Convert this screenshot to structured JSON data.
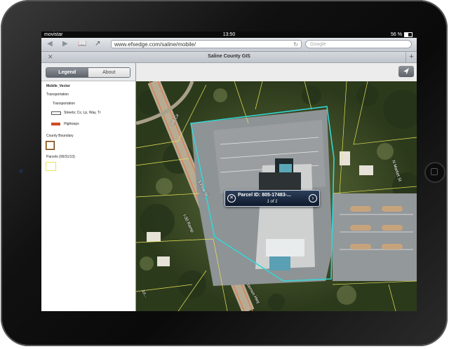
{
  "status": {
    "carrier": "movistar",
    "time": "13:50",
    "battery": "56 %"
  },
  "browser": {
    "url": "www.efsedge.com/saline/mobile/",
    "search_placeholder": "Google",
    "tab_title": "Saline County GIS",
    "icons": [
      "back-arrow-icon",
      "forward-arrow-icon",
      "bookmarks-icon",
      "share-icon",
      "reload-icon",
      "close-tab-icon",
      "add-tab-icon"
    ]
  },
  "panel": {
    "tabs": [
      {
        "label": "Legend",
        "active": true
      },
      {
        "label": "About",
        "active": false
      }
    ],
    "legend": {
      "service": "Mobile_Vector",
      "group": "Transportation",
      "sublayer": "Transportation",
      "streets": "Streets; Cs; Lp, Way, Tr",
      "highways": "Highways",
      "county": "County Boundary",
      "parcels": "Parcels (00/31/13)"
    }
  },
  "map": {
    "locate_icon": "location-arrow-icon",
    "roads": [
      "Hill Cir",
      "S Pine St",
      "I-30 Ramp",
      "Jct...",
      "Vernon Hwy",
      "N Market St"
    ],
    "popup": {
      "title": "Parcel ID: 805-17483-...",
      "subtitle": "1 of 1"
    },
    "colors": {
      "parcel_line": "#e8e45a",
      "selected_parcel": "#35d6d6",
      "highway": "#e07a4a"
    }
  }
}
